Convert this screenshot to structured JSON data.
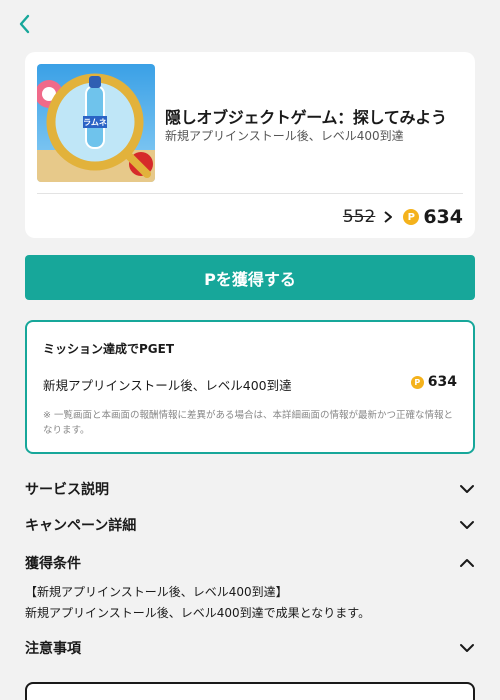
{
  "header": {
    "back_icon": "chevron-left-icon"
  },
  "offer": {
    "title": "隠しオブジェクトゲーム：探してみよう",
    "subtitle": "新規アプリインストール後、レベル400到達",
    "old_price": "552",
    "new_price": "634",
    "coin_symbol": "P",
    "thumbnail": "ramune-bottle-magnifier-image"
  },
  "cta": {
    "label": "Pを獲得する"
  },
  "mission": {
    "title": "ミッション達成でPGET",
    "description": "新規アプリインストール後、レベル400到達",
    "points": "634",
    "note": "※ 一覧画面と本画面の報酬情報に差異がある場合は、本詳細画面の情報が最新かつ正確な情報となります。"
  },
  "sections": {
    "service": {
      "label": "サービス説明",
      "icon": "chevron-down-icon"
    },
    "campaign": {
      "label": "キャンペーン詳細",
      "icon": "chevron-down-icon"
    },
    "conditions": {
      "label": "獲得条件",
      "icon": "chevron-up-icon",
      "line1": "【新規アプリインストール後、レベル400到達】",
      "line2": "新規アプリインストール後、レベル400到達で成果となります。"
    },
    "notes": {
      "label": "注意事項",
      "icon": "chevron-down-icon"
    }
  },
  "colors": {
    "accent": "#17a79a",
    "coin": "#f4b21c",
    "background": "#f2f2f2"
  }
}
